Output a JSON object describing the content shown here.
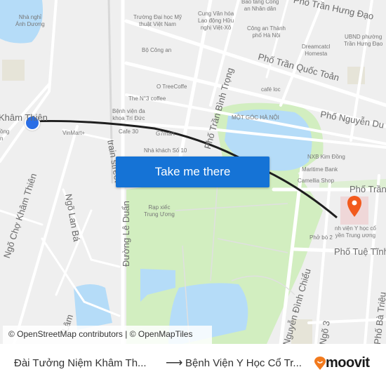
{
  "map": {
    "place_labels": [
      {
        "id": "nha-nghi",
        "text": "Nhà nghỉ\nÁnh Dương"
      },
      {
        "id": "dh-my-thuat",
        "text": "Trường Đại học Mỹ\nthuật Việt Nam"
      },
      {
        "id": "cung-van-hoa",
        "text": "Cung Văn hóa\nLao động Hữu\nnghị Việt-Xô"
      },
      {
        "id": "bao-tang",
        "text": "Bảo tàng Công\nan Nhân dân"
      },
      {
        "id": "cong-an-tp",
        "text": "Công an Thành\nphố Hà Nội"
      },
      {
        "id": "ubnd",
        "text": "UBND phường\nTrần Hưng Đạo"
      },
      {
        "id": "dreamcatcher",
        "text": "Dreamcatcl\nHomesta"
      },
      {
        "id": "bo-cong-an",
        "text": "Bộ Công an"
      },
      {
        "id": "o-tree",
        "text": "O TreeCoffe"
      },
      {
        "id": "cafe-loc",
        "text": "café loc"
      },
      {
        "id": "n3-coffee",
        "text": "The N°3 coffee"
      },
      {
        "id": "benh-vien-tri-duc",
        "text": "Bệnh viện đa\nkhoa Trí Đức"
      },
      {
        "id": "cafe-30",
        "text": "Cafe 30"
      },
      {
        "id": "g7mart",
        "text": "G7mart"
      },
      {
        "id": "vinmart",
        "text": "VinMart+"
      },
      {
        "id": "nha-khach",
        "text": "Nhà khách Số 10"
      },
      {
        "id": "mot-goc",
        "text": "MỘT GÓC HÀ NỘI"
      },
      {
        "id": "nxb",
        "text": "NXB Kim Đồng"
      },
      {
        "id": "maritime",
        "text": "Maritime Bank"
      },
      {
        "id": "camellia",
        "text": "Camellia Shop"
      },
      {
        "id": "rap-xiec",
        "text": "Rạp xiếc\nTrung Ương"
      },
      {
        "id": "benh-vien-yhct",
        "text": "nh viện Y học cổ\nyền Trung ương"
      },
      {
        "id": "pho-bo",
        "text": "Phở bò 2"
      },
      {
        "id": "khamthien-frag",
        "text": "ồng\nn"
      }
    ],
    "street_labels": [
      {
        "id": "tran-hung-dao",
        "text": "Phố Trần Hưng Đạo"
      },
      {
        "id": "tran-quoc-toan",
        "text": "Phố Trần Quốc Toản"
      },
      {
        "id": "nguyen-du",
        "text": "Phố Nguyễn Du"
      },
      {
        "id": "tran-binh-trong",
        "text": "Phố Trần Bình Trọng"
      },
      {
        "id": "train-street",
        "text": "train street"
      },
      {
        "id": "le-duan",
        "text": "Đường Lê Duẩn"
      },
      {
        "id": "kham-thien",
        "text": "Khâm Thiên"
      },
      {
        "id": "ngo-cho-kham-thien",
        "text": "Ngõ Chợ Khâm Thiên"
      },
      {
        "id": "ngo-lan-ba",
        "text": "Ngõ Lan Bá"
      },
      {
        "id": "pho-tran",
        "text": "Phố Trần"
      },
      {
        "id": "tue-tinh",
        "text": "Phố Tuệ Tĩnh"
      },
      {
        "id": "nguyen-dinh-chieu",
        "text": "Nguyễn Đình Chiểu"
      },
      {
        "id": "ngo-3",
        "text": "Ngõ 3"
      },
      {
        "id": "ba-trieu",
        "text": "Phố Bà Triệu"
      },
      {
        "id": "lam",
        "text": "Lâm"
      }
    ],
    "cta_label": "Take me there",
    "attribution": "© OpenStreetMap contributors | © OpenMapTiles",
    "colors": {
      "route": "#1e1e1e",
      "origin": "#2a6ee6",
      "destination": "#f25a1d",
      "water": "#b5dcf8",
      "park": "#d2eec0",
      "button": "#1573d6"
    }
  },
  "footer": {
    "from": "Đài Tưởng Niệm Khâm Th...",
    "arrow": "⟶",
    "to": "Bệnh Viện Y Học Cổ Tr...",
    "brand": "moovit"
  }
}
